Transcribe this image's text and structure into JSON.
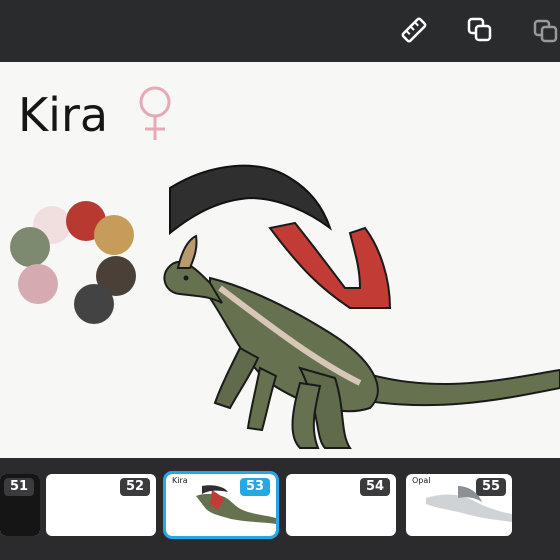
{
  "toolbar": {
    "icons": [
      "ruler-icon",
      "duplicate-icon",
      "layers-icon"
    ]
  },
  "canvas": {
    "title": "Kira",
    "symbol": "female-symbol",
    "palette_colors": [
      "#f1dfe0",
      "#b8392f",
      "#c79b5a",
      "#7e8a6f",
      "#d5aab0",
      "#4a4038",
      "#434343"
    ]
  },
  "pages": {
    "items": [
      {
        "number": "51",
        "label": ""
      },
      {
        "number": "52",
        "label": ""
      },
      {
        "number": "53",
        "label": "Kira",
        "selected": true
      },
      {
        "number": "54",
        "label": ""
      },
      {
        "number": "55",
        "label": "Opal"
      }
    ]
  }
}
